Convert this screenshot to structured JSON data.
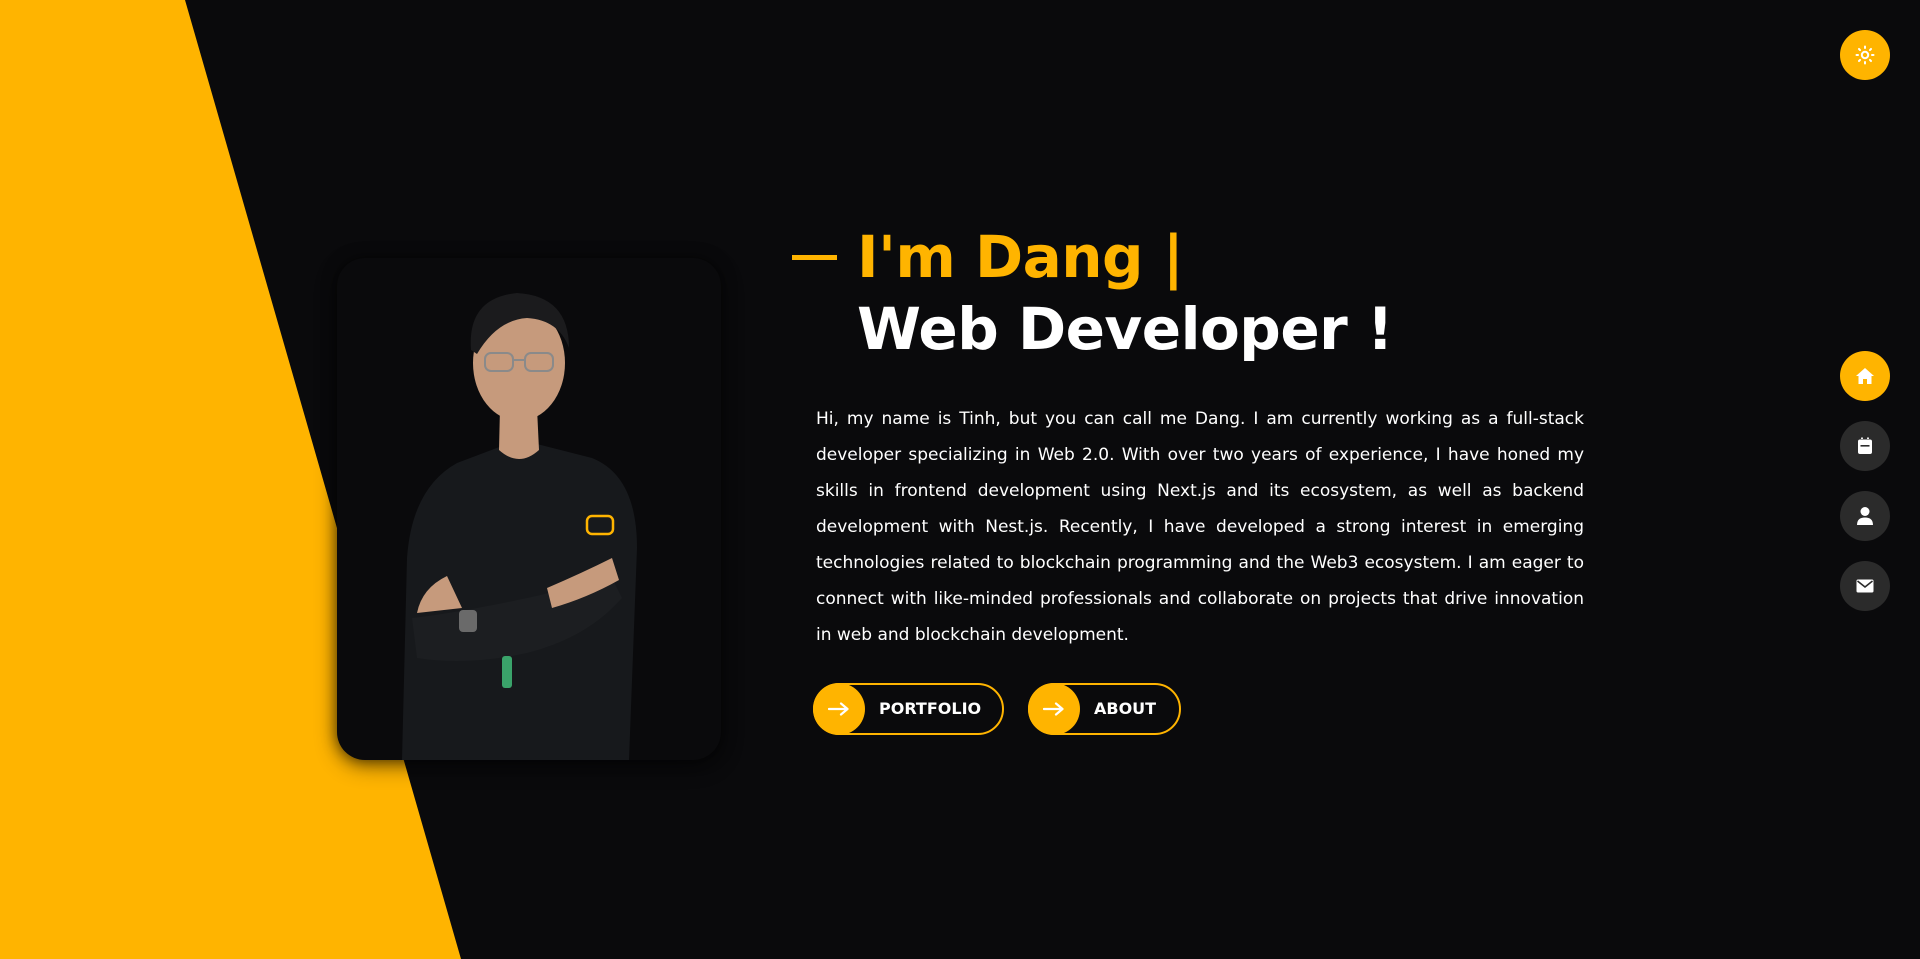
{
  "colors": {
    "accent": "#ffb400",
    "background": "#0a0a0c",
    "nav_inactive": "#2b2b2b",
    "text": "#ffffff"
  },
  "theme_toggle": {
    "icon": "sun-icon"
  },
  "hero": {
    "heading_line1": "I'm Dang |",
    "heading_line2": "Web Developer !",
    "bio": "Hi, my name is Tinh, but you can call me Dang. I am currently working as a full-stack developer specializing in Web 2.0. With over two years of experience, I have honed my skills in frontend development using Next.js and its ecosystem, as well as backend development with Nest.js. Recently, I have developed a strong interest in emerging technologies related to blockchain programming and the Web3 ecosystem. I am eager to connect with like-minded professionals and collaborate on projects that drive innovation in web and blockchain development.",
    "photo": {
      "icon": "profile-photo"
    }
  },
  "buttons": [
    {
      "label": "PORTFOLIO",
      "icon": "arrow-right-icon"
    },
    {
      "label": "ABOUT",
      "icon": "arrow-right-icon"
    }
  ],
  "side_nav": [
    {
      "icon": "home-icon",
      "active": true
    },
    {
      "icon": "briefcase-icon",
      "active": false
    },
    {
      "icon": "user-icon",
      "active": false
    },
    {
      "icon": "mail-icon",
      "active": false
    }
  ]
}
